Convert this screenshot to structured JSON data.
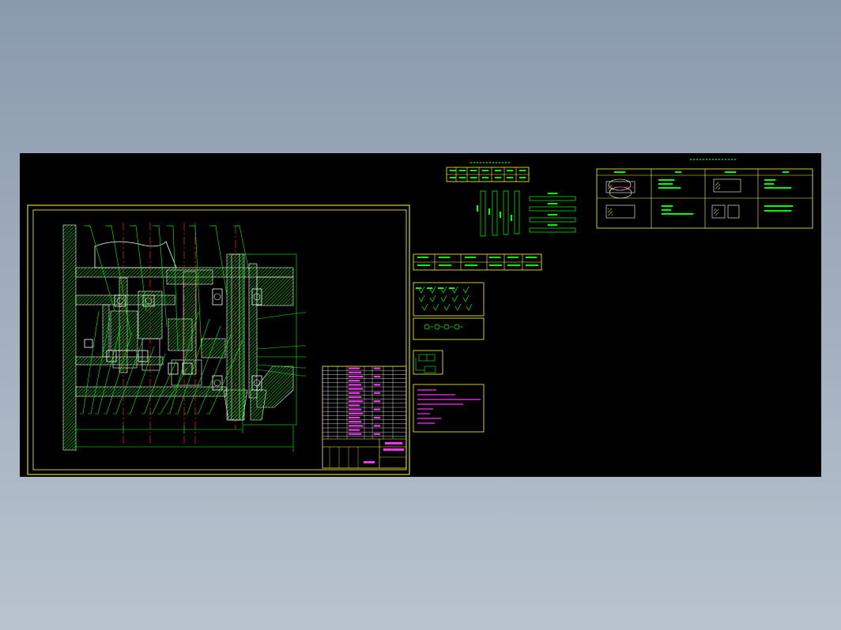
{
  "viewport": {
    "background": "#000000",
    "colors": {
      "frame": "#ffff33",
      "hatch": "#00ff00",
      "green": "#00ff00",
      "magenta": "#ff33ff",
      "red": "#ff2222",
      "white": "#ffffff",
      "cyan": "#33ffff"
    }
  },
  "drawing": {
    "name": "gearbox-assembly-section-drawing",
    "leader_count_top": 8,
    "leader_count_bottom": 14,
    "right_leader_count": 5,
    "parts_list_rows": 17
  },
  "panels": {
    "tool_table_rows": 2,
    "shaft_sketch_count": 4,
    "bar_sketch_count": 4,
    "process_table_rows": 2,
    "process_table_cols": 4
  }
}
